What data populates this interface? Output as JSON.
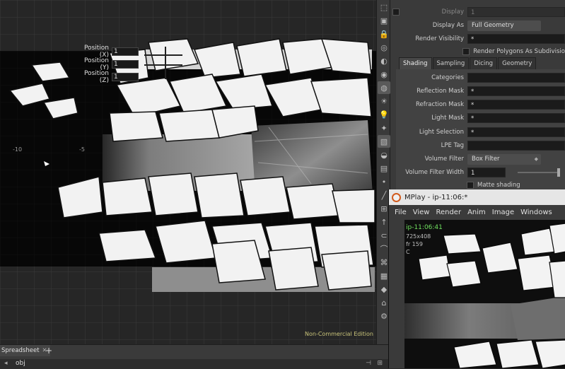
{
  "viewport": {
    "position_fields": [
      {
        "label": "Position (X)",
        "value": "1"
      },
      {
        "label": "Position (Y)",
        "value": "1"
      },
      {
        "label": "Position (Z)",
        "value": "1"
      }
    ],
    "axis_ticks": [
      "-10",
      "-5"
    ],
    "edition_label": "Non-Commercial Edition"
  },
  "params": {
    "display": {
      "label": "Display",
      "value": "1"
    },
    "display_as": {
      "label": "Display As",
      "value": "Full Geometry"
    },
    "render_visibility": {
      "label": "Render Visibility",
      "value": "*"
    },
    "render_polygons": {
      "label": "Render Polygons As Subdivisio"
    },
    "tabs": [
      "Shading",
      "Sampling",
      "Dicing",
      "Geometry"
    ],
    "rows": [
      {
        "label": "Categories",
        "value": ""
      },
      {
        "label": "Reflection Mask",
        "value": "*"
      },
      {
        "label": "Refraction Mask",
        "value": "*"
      },
      {
        "label": "Light Mask",
        "value": "*"
      },
      {
        "label": "Light Selection",
        "value": "*"
      },
      {
        "label": "LPE Tag",
        "value": ""
      }
    ],
    "volume_filter": {
      "label": "Volume Filter",
      "value": "Box Filter"
    },
    "volume_filter_width": {
      "label": "Volume Filter Width",
      "value": "1"
    },
    "matte_shading": {
      "label": "Matte shading"
    }
  },
  "mplay": {
    "title": "MPlay - ip-11:06:*",
    "menu": [
      "File",
      "View",
      "Render",
      "Anim",
      "Image",
      "Windows"
    ],
    "info": {
      "name": "ip-11:06:41",
      "resolution": "725x408",
      "frame": "fr 159",
      "channel": "C"
    }
  },
  "bottom": {
    "tab_label": "Spreadsheet",
    "path": "obj"
  },
  "colors": {
    "viewport_bg": "#262626",
    "panel_bg": "#3a3a3a",
    "edition_text": "#c9c47a",
    "mplay_highlight": "#6fe05f"
  }
}
